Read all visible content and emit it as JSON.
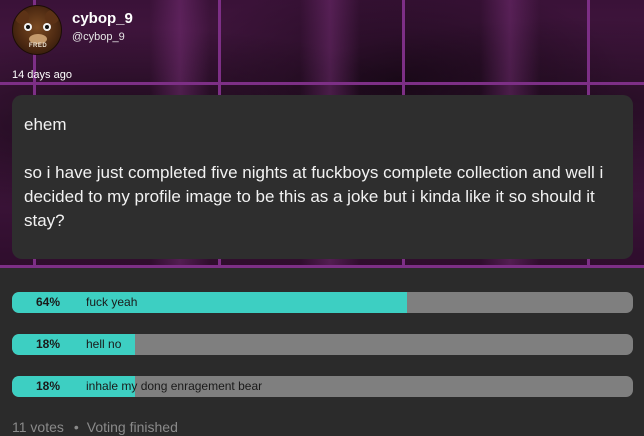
{
  "author": {
    "username": "cybop_9",
    "handle": "@cybop_9",
    "avatar_icon": "freddy-fazbear-avatar",
    "avatar_tag": "FRED"
  },
  "post": {
    "time_ago": "14 days ago",
    "line1": "ehem",
    "line2": "so i have just completed five nights at fuckboys complete collection and well i decided to my profile image to be this as a joke but i kinda like it so should it stay?"
  },
  "poll": {
    "options": [
      {
        "label": "fuck yeah",
        "percent_label": "64%",
        "percent": 64
      },
      {
        "label": "hell no",
        "percent_label": "18%",
        "percent": 18
      },
      {
        "label": "inhale my dong enragement bear",
        "percent_label": "18%",
        "percent": 18
      }
    ],
    "votes": "11 votes",
    "status": "Voting finished",
    "colors": {
      "fill": "#3dcfc2",
      "track": "#7f7f7f"
    }
  },
  "theme": {
    "background": "#2b2b2b",
    "header_grid": "#7d2f86",
    "card": "#2e2e2e"
  }
}
